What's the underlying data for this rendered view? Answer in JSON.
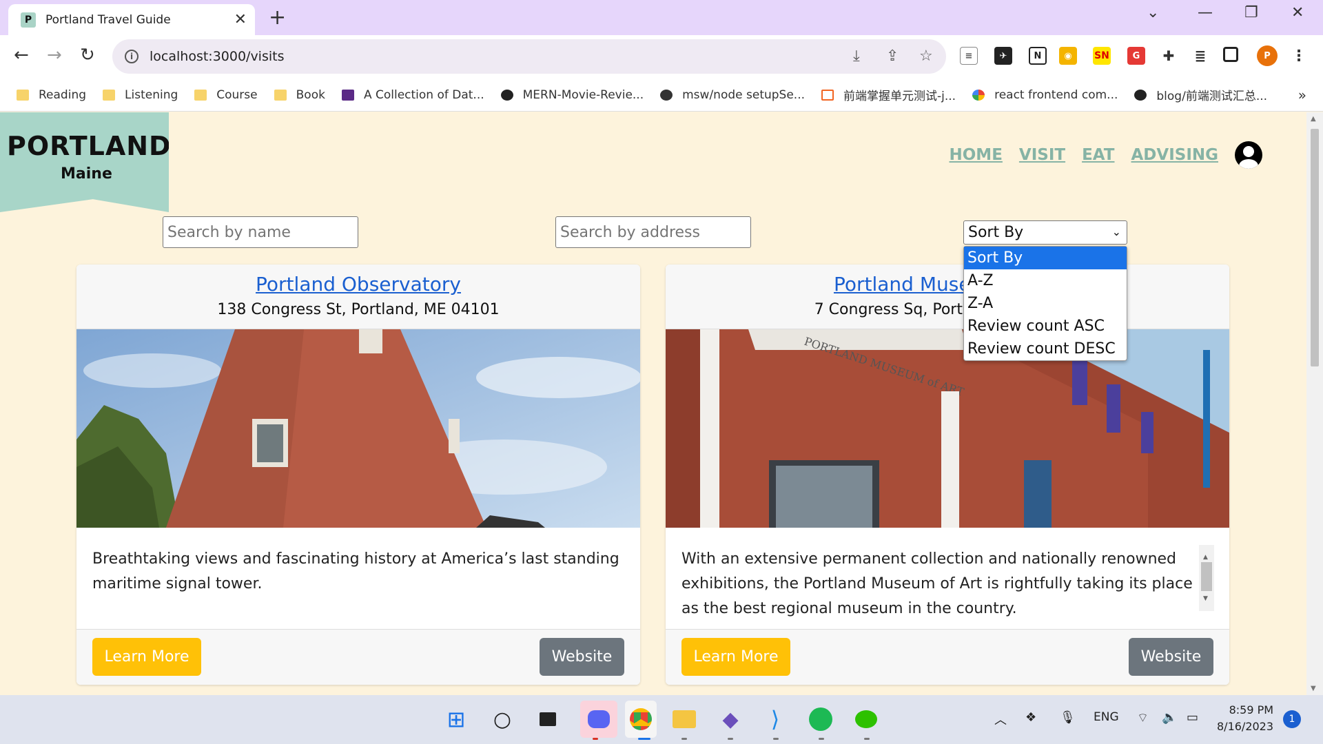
{
  "browser": {
    "tab_title": "Portland Travel Guide",
    "tab_favicon": "P",
    "url": "localhost:3000/visits",
    "bookmarks": [
      {
        "label": "Reading",
        "icon": "folder-icon"
      },
      {
        "label": "Listening",
        "icon": "folder-icon"
      },
      {
        "label": "Course",
        "icon": "folder-icon"
      },
      {
        "label": "Book",
        "icon": "folder-icon"
      },
      {
        "label": "A Collection of Dat...",
        "icon": "book-icon"
      },
      {
        "label": "MERN-Movie-Revie...",
        "icon": "github-icon"
      },
      {
        "label": "msw/node setupSe...",
        "icon": "globe-icon"
      },
      {
        "label": "前端掌握单元测试-j...",
        "icon": "bracket-icon"
      },
      {
        "label": "react frontend com...",
        "icon": "google-icon"
      },
      {
        "label": "blog/前端测试汇总...",
        "icon": "github-icon"
      }
    ],
    "profile_initial": "P"
  },
  "site": {
    "logo_title": "PORTLAND",
    "logo_subtitle": "Maine",
    "nav": [
      "HOME",
      "VISIT",
      "EAT",
      "ADVISING"
    ]
  },
  "filters": {
    "search_name_placeholder": "Search by name",
    "search_address_placeholder": "Search by address",
    "sort_selected": "Sort By",
    "sort_options": [
      "Sort By",
      "A-Z",
      "Z-A",
      "Review count ASC",
      "Review count DESC"
    ]
  },
  "cards": [
    {
      "title": "Portland Observatory",
      "address": "138 Congress St, Portland, ME 04101",
      "description": "Breathtaking views and fascinating history at America’s last standing maritime signal tower.",
      "learn_more": "Learn More",
      "website": "Website"
    },
    {
      "title": "Portland Museum of Art",
      "address": "7 Congress Sq, Portland, ME 04101",
      "description": "With an extensive permanent collection and nationally renowned exhibitions, the Portland Museum of Art is rightfully taking its place as the best regional museum in the country.",
      "image_sign": "PORTLAND MUSEUM of ART",
      "learn_more": "Learn More",
      "website": "Website"
    }
  ],
  "taskbar": {
    "language": "ENG",
    "time": "8:59 PM",
    "date": "8/16/2023",
    "notifications": "1"
  },
  "colors": {
    "page_bg": "#fdf3dc",
    "logo_bg": "#a8d5c8",
    "nav_link": "#86b3a5",
    "learn_more": "#ffc107",
    "website": "#6c757d",
    "link": "#1a5fd0"
  }
}
